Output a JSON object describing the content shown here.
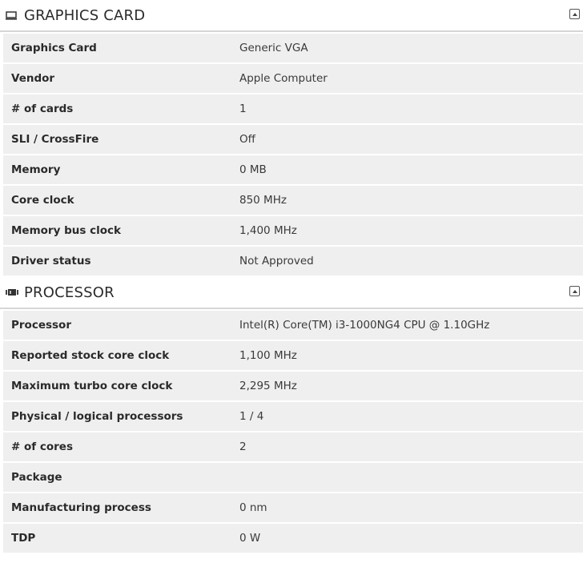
{
  "sections": [
    {
      "title": "GRAPHICS CARD",
      "icon": "monitor-icon",
      "rows": [
        {
          "label": "Graphics Card",
          "value": "Generic VGA"
        },
        {
          "label": "Vendor",
          "value": "Apple Computer"
        },
        {
          "label": "# of cards",
          "value": "1"
        },
        {
          "label": "SLI / CrossFire",
          "value": "Off"
        },
        {
          "label": "Memory",
          "value": "0 MB"
        },
        {
          "label": "Core clock",
          "value": "850 MHz"
        },
        {
          "label": "Memory bus clock",
          "value": "1,400 MHz"
        },
        {
          "label": "Driver status",
          "value": "Not Approved"
        }
      ]
    },
    {
      "title": "PROCESSOR",
      "icon": "cpu-chip-icon",
      "rows": [
        {
          "label": "Processor",
          "value": "Intel(R) Core(TM) i3-1000NG4 CPU @ 1.10GHz"
        },
        {
          "label": "Reported stock core clock",
          "value": "1,100 MHz"
        },
        {
          "label": "Maximum turbo core clock",
          "value": "2,295 MHz"
        },
        {
          "label": "Physical / logical processors",
          "value": "1 / 4"
        },
        {
          "label": "# of cores",
          "value": "2"
        },
        {
          "label": "Package",
          "value": ""
        },
        {
          "label": "Manufacturing process",
          "value": "0 nm"
        },
        {
          "label": "TDP",
          "value": "0 W"
        }
      ]
    }
  ]
}
